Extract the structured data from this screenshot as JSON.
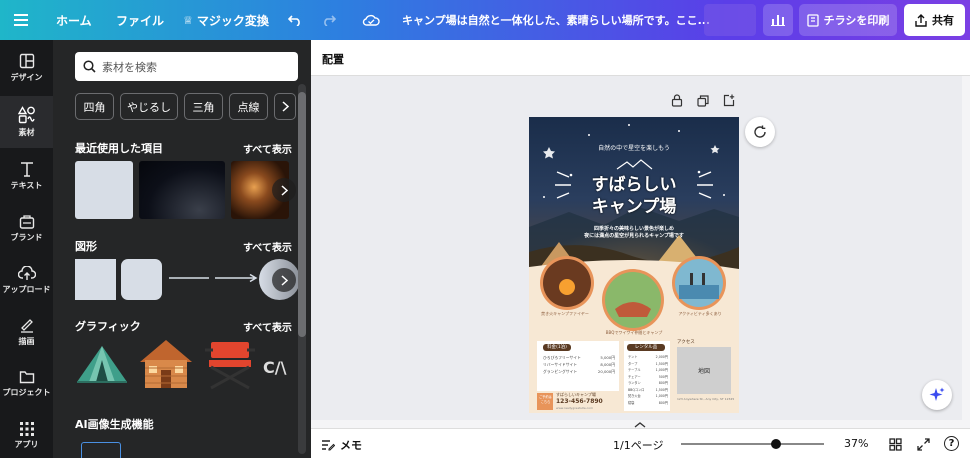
{
  "topbar": {
    "home": "ホーム",
    "file": "ファイル",
    "magic": "マジック変換",
    "doc_title": "キャンプ場は自然と一体化した、素晴らしい場所です。ここ...",
    "print_label": "チラシを印刷",
    "share_label": "共有"
  },
  "sidebar": {
    "items": [
      {
        "label": "デザイン",
        "icon": "layout-icon"
      },
      {
        "label": "素材",
        "icon": "elements-icon"
      },
      {
        "label": "テキスト",
        "icon": "text-icon"
      },
      {
        "label": "ブランド",
        "icon": "brand-icon"
      },
      {
        "label": "アップロード",
        "icon": "upload-icon"
      },
      {
        "label": "描画",
        "icon": "draw-icon"
      },
      {
        "label": "プロジェクト",
        "icon": "folder-icon"
      },
      {
        "label": "アプリ",
        "icon": "apps-icon"
      }
    ]
  },
  "panel": {
    "search_placeholder": "素材を検索",
    "chips": [
      "四角",
      "やじるし",
      "三角",
      "点線"
    ],
    "recent_title": "最近使用した項目",
    "shapes_title": "図形",
    "graphics_title": "グラフィック",
    "ai_title": "AI画像生成機能",
    "see_all": "すべて表示"
  },
  "canvas": {
    "section_label": "配置",
    "memo_label": "メモ",
    "page_indicator": "1/1ページ",
    "zoom": "37%",
    "zoom_level": 0.37
  },
  "poster": {
    "arc_text": "自然の中で星空を楽しもう",
    "title_line1": "すばらしい",
    "title_line2": "キャンプ場",
    "desc_line1": "四季折々の美味らしい景色が楽しめ",
    "desc_line2": "夜には満点の星空が見られるキャンプ場です",
    "circle_labels": [
      "焚き火キャンプファイヤー",
      "BBQでワイワイ仲間とキャンプ",
      "アクティビティ多くあり"
    ],
    "fee_title": "料金",
    "fee_unit": "(1泊)",
    "fees": [
      {
        "name": "ひろびろフリーサイト",
        "price": "5,000円"
      },
      {
        "name": "リバーサイドサイト",
        "price": "8,000円"
      },
      {
        "name": "グランピングサイト",
        "price": "20,000円"
      }
    ],
    "rental_title": "レンタル品",
    "rentals": [
      {
        "name": "テント",
        "price": "2,000円"
      },
      {
        "name": "タープ",
        "price": "1,500円"
      },
      {
        "name": "テーブル",
        "price": "1,000円"
      },
      {
        "name": "チェアー",
        "price": "500円"
      },
      {
        "name": "ランタン",
        "price": "800円"
      },
      {
        "name": "BBQコンロ",
        "price": "1,500円"
      },
      {
        "name": "焚き火台",
        "price": "1,000円"
      },
      {
        "name": "寝袋",
        "price": "800円"
      }
    ],
    "access_label": "アクセス",
    "map_label": "地図",
    "address": "123 Anywhere St., Any City, ST 12345",
    "booking_label_1": "ご予約は",
    "booking_label_2": "こちら",
    "camp_name": "すばらしいキャンプ場",
    "phone": "123-456-7890",
    "website": "www.reallygreatsite.com"
  },
  "colors": {
    "accent_purple": "#7b3fe4",
    "accent_cyan": "#1fb6c9",
    "poster_orange": "#e8945a",
    "poster_brown": "#5a3a22"
  }
}
